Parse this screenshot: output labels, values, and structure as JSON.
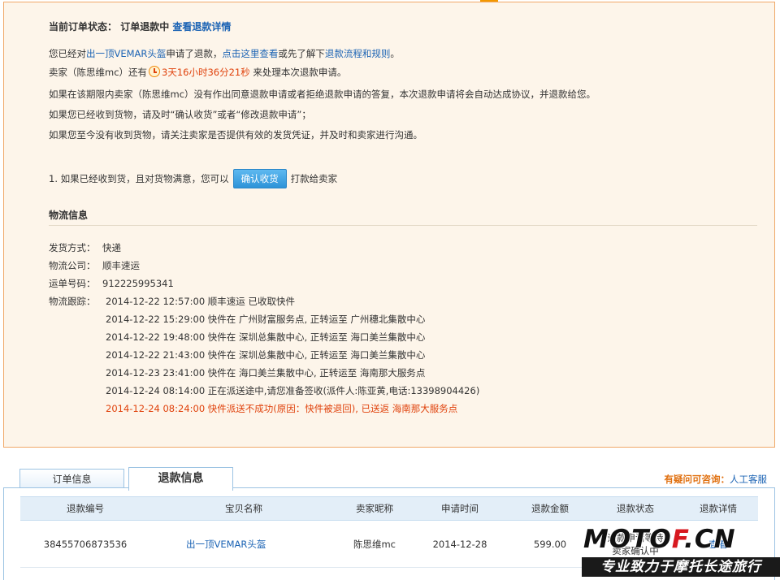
{
  "status": {
    "label": "当前订单状态：",
    "value": "订单退款中",
    "details_link": "查看退款详情"
  },
  "notice": {
    "line1_pre": "您已经对",
    "item_link": "出一顶VEMAR头盔",
    "line1_mid": "申请了退款，",
    "view_link": "点击这里查看",
    "line1_mid2": "或先了解下",
    "rules_link": "退款流程和规则",
    "line1_end": "。",
    "line2_pre": "卖家（陈思维mc）还有",
    "timer": "3天16小时36分21秒",
    "line2_post": " 来处理本次退款申请。",
    "line3": "如果在该期限内卖家（陈思维mc）没有作出同意退款申请或者拒绝退款申请的答复，本次退款申请将会自动达成协议，并退款给您。",
    "line4": "如果您已经收到货物，请及时“确认收货”或者“修改退款申请”；",
    "line5": "如果您至今没有收到货物，请关注卖家是否提供有效的发货凭证，并及时和卖家进行沟通。"
  },
  "confirm": {
    "pre": "1. 如果已经收到货，且对货物满意，您可以",
    "button": "确认收货",
    "post": "打款给卖家"
  },
  "logistics": {
    "title": "物流信息",
    "ship_label": "发货方式：",
    "ship_value": "快递",
    "company_label": "物流公司：",
    "company_value": "顺丰速运",
    "tracking_label": "运单号码：",
    "tracking_value": "912225995341",
    "trace_label": "物流跟踪：",
    "entries": [
      "2014-12-22 12:57:00 顺丰速运 已收取快件",
      "2014-12-22 15:29:00 快件在 广州财富服务点, 正转运至 广州穗北集散中心",
      "2014-12-22 19:48:00 快件在 深圳总集散中心, 正转运至 海口美兰集散中心",
      "2014-12-22 21:43:00 快件在 深圳总集散中心, 正转运至 海口美兰集散中心",
      "2014-12-23 23:41:00 快件在 海口美兰集散中心, 正转运至 海南那大服务点",
      "2014-12-24 08:14:00 正在派送途中,请您准备签收(派件人:陈亚黄,电话:13398904426)",
      "2014-12-24 08:24:00 快件派送不成功(原因：快件被退回), 已送返 海南那大服务点"
    ]
  },
  "tabs": [
    {
      "label": "订单信息"
    },
    {
      "label": "退款信息"
    }
  ],
  "help": {
    "label": "有疑问可咨询：",
    "link": "人工客服"
  },
  "table": {
    "headers": [
      "退款编号",
      "宝贝名称",
      "卖家昵称",
      "申请时间",
      "退款金额",
      "退款状态",
      "退款详情"
    ],
    "rows": [
      [
        "38455706873536",
        "出一顶VEMAR头盔",
        "陈思维mc",
        "2014-12-28",
        "599.00",
        "退款申请等待卖家确认中",
        "查看"
      ]
    ]
  },
  "watermark": {
    "top_dark": "MOTO",
    "top_red": "F",
    "top_tail": ".CN",
    "bottom": "专业致力于摩托长途旅行"
  }
}
